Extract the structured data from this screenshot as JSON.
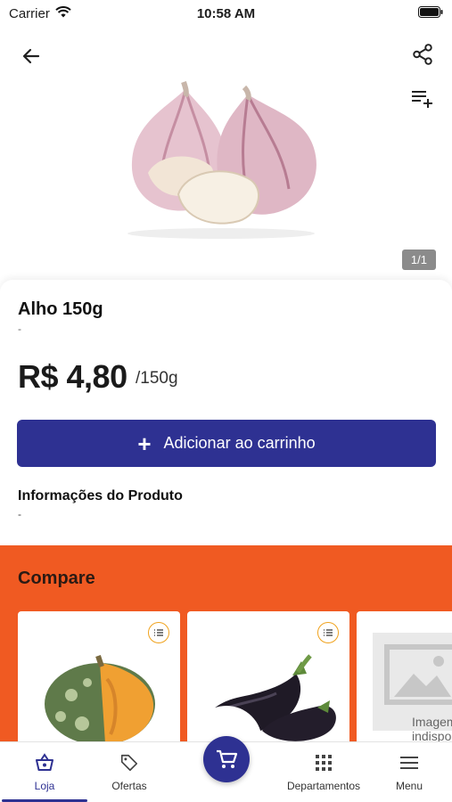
{
  "status_bar": {
    "carrier": "Carrier",
    "time": "10:58 AM"
  },
  "gallery": {
    "counter": "1/1",
    "image_icon": "garlic-image"
  },
  "product": {
    "name": "Alho 150g",
    "subtitle": "-",
    "price": "R$ 4,80",
    "unit": "/150g",
    "add_to_cart_label": "Adicionar ao carrinho",
    "info_title": "Informações do Produto",
    "info_value": "-"
  },
  "compare": {
    "title": "Compare",
    "items": [
      {
        "image_icon": "pumpkin-image"
      },
      {
        "image_icon": "eggplant-image"
      },
      {
        "image_icon": "image-unavailable-placeholder",
        "placeholder_line1": "Imagem",
        "placeholder_line2": "indisponível"
      }
    ]
  },
  "nav": {
    "items": [
      {
        "label": "Loja",
        "icon": "basket-icon"
      },
      {
        "label": "Ofertas",
        "icon": "tag-icon"
      },
      {
        "label": "Departamentos",
        "icon": "grid-icon"
      },
      {
        "label": "Menu",
        "icon": "hamburger-icon"
      }
    ],
    "cart_icon": "cart-icon"
  },
  "colors": {
    "primary": "#2e3192",
    "accent": "#f05a22",
    "compare_icon_border": "#f0a21c"
  }
}
